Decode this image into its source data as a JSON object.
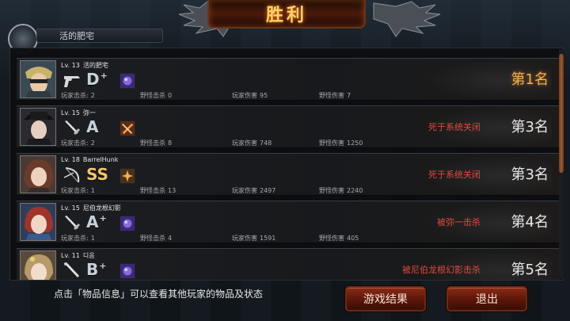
{
  "header": {
    "title": "胜利",
    "top_tab_label": "活的肥宅"
  },
  "players": [
    {
      "level": "Lv. 13",
      "name": "活的肥宅",
      "weapon_icon": "pistol-icon",
      "grade": "D",
      "grade_plus": "+",
      "player_kills_label": "玩家击杀:",
      "player_kills": "2",
      "monster_kills_label": "野怪击杀",
      "monster_kills": "0",
      "player_damage_label": "玩家伤害",
      "player_damage": "95",
      "monster_damage_label": "野怪伤害",
      "monster_damage": "7",
      "death_text": "",
      "rank": "第1名"
    },
    {
      "level": "Lv. 15",
      "name": "弥一",
      "weapon_icon": "sword-icon",
      "grade": "A",
      "grade_plus": "",
      "player_kills_label": "玩家击杀:",
      "player_kills": "2",
      "monster_kills_label": "野怪击杀",
      "monster_kills": "8",
      "player_damage_label": "玩家伤害",
      "player_damage": "748",
      "monster_damage_label": "野怪伤害",
      "monster_damage": "1250",
      "death_text": "死于系统关闭",
      "rank": "第3名"
    },
    {
      "level": "Lv. 18",
      "name": "BarrelHunk",
      "weapon_icon": "bow-icon",
      "grade": "SS",
      "grade_plus": "",
      "player_kills_label": "玩家击杀:",
      "player_kills": "1",
      "monster_kills_label": "野怪击杀",
      "monster_kills": "13",
      "player_damage_label": "玩家伤害",
      "player_damage": "2497",
      "monster_damage_label": "野怪伤害",
      "monster_damage": "2240",
      "death_text": "死于系统关闭",
      "rank": "第3名"
    },
    {
      "level": "Lv. 15",
      "name": "尼伯龙根幻影",
      "weapon_icon": "sword-icon",
      "grade": "A",
      "grade_plus": "+",
      "player_kills_label": "玩家击杀:",
      "player_kills": "1",
      "monster_kills_label": "野怪击杀",
      "monster_kills": "4",
      "player_damage_label": "玩家伤害",
      "player_damage": "1591",
      "monster_damage_label": "野怪伤害",
      "monster_damage": "405",
      "death_text": "被弥一击杀",
      "rank": "第4名"
    },
    {
      "level": "Lv. 11",
      "name": "디옴",
      "weapon_icon": "bat-icon",
      "grade": "B",
      "grade_plus": "+",
      "player_kills_label": "",
      "player_kills": "",
      "monster_kills_label": "",
      "monster_kills": "",
      "player_damage_label": "",
      "player_damage": "",
      "monster_damage_label": "",
      "monster_damage": "",
      "death_text": "被尼伯龙根幻影击杀",
      "rank": "第5名"
    }
  ],
  "footer": {
    "hint": "点击「物品信息」可以查看其他玩家的物品及状态",
    "result_button": "游戏结果",
    "exit_button": "退出"
  },
  "colors": {
    "rank_first": "#f0b14a",
    "death_text": "#e04a3a",
    "button_red": "#8a2a16"
  }
}
